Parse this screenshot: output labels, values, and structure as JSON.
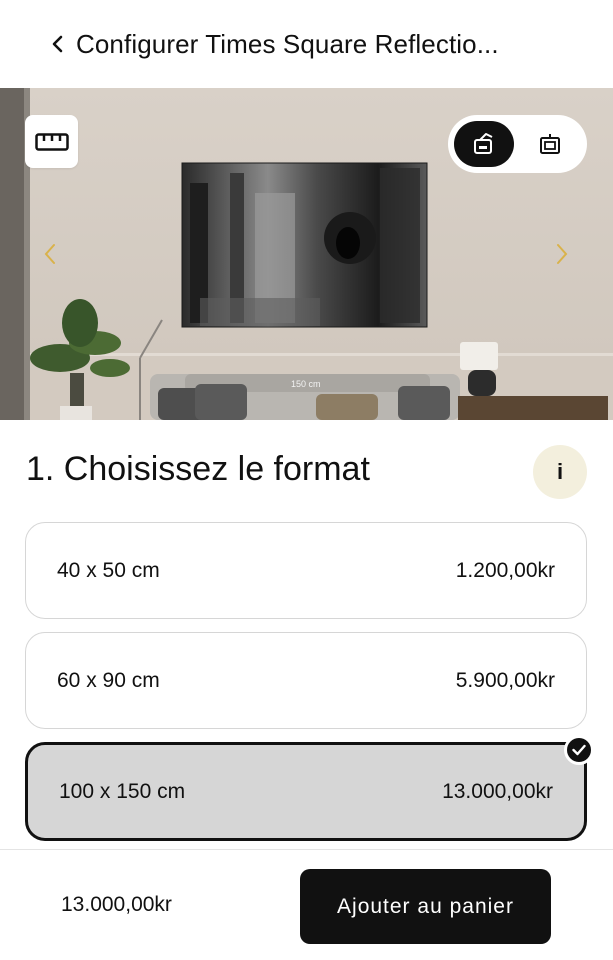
{
  "header": {
    "title": "Configurer Times Square Reflectio..."
  },
  "icons": {
    "back": "chevron-left-icon",
    "ruler": "ruler-icon",
    "view_active": "framed-artwork-icon",
    "view_inactive": "wall-frame-icon",
    "prev": "chevron-left-icon",
    "next": "chevron-right-icon",
    "info": "info-icon",
    "selected": "check-icon"
  },
  "preview": {
    "dimension_label": "150 cm"
  },
  "section": {
    "title": "1. Choisissez le format",
    "info_label": "i"
  },
  "options": [
    {
      "size": "40 x 50 cm",
      "price": "1.200,00kr",
      "selected": false
    },
    {
      "size": "60 x 90 cm",
      "price": "5.900,00kr",
      "selected": false
    },
    {
      "size": "100 x 150 cm",
      "price": "13.000,00kr",
      "selected": true
    }
  ],
  "footer": {
    "total": "13.000,00kr",
    "add_to_cart_label": "Ajouter au panier"
  },
  "colors": {
    "accent_dark": "#111111",
    "selected_bg": "#d6d6d6",
    "info_bg": "#f3efdd",
    "nav_arrow": "#d9b24a"
  }
}
